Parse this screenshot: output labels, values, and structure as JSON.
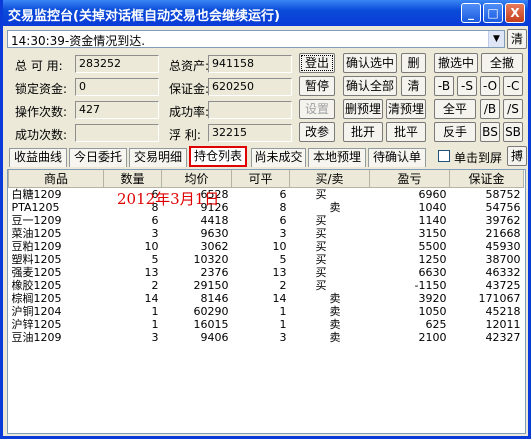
{
  "window": {
    "title": "交易监控台(关掉对话框自动交易也会继续运行)",
    "min_label": "_",
    "max_label": "□",
    "close_label": "X"
  },
  "status": {
    "message": "14:30:39-资金情况到达.",
    "clear_label": "清"
  },
  "account": {
    "available_label": "总 可 用:",
    "available_value": "283252",
    "total_assets_label": "总资产:",
    "total_assets_value": "941158",
    "locked_label": "锁定资金:",
    "locked_value": "0",
    "margin_label": "保证金:",
    "margin_value": "620250",
    "ops_label": "操作次数:",
    "ops_value": "427",
    "success_rate_label": "成功率:",
    "success_rate_value": "",
    "success_count_label": "成功次数:",
    "success_count_value": "",
    "float_pnl_label": "浮  利:",
    "float_pnl_value": "32215"
  },
  "controls": {
    "login": "登出",
    "pause": "暂停",
    "settings": "设置",
    "change_params": "改参",
    "confirm_selected": "确认选中",
    "delete": "删",
    "withdraw_selected": "撤选中",
    "withdraw_all": "全撤",
    "confirm_all": "确认全部",
    "clear": "清",
    "minus_b": "-B",
    "minus_s": "-S",
    "minus_o": "-O",
    "minus_c": "-C",
    "delete_preorder": "删预埋",
    "clear_preorder": "清预埋",
    "close_all": "全平",
    "slash_b": "/B",
    "slash_s": "/S",
    "batch_open": "批开",
    "batch_close": "批平",
    "reverse": "反手",
    "bs": "BS",
    "sb": "SB"
  },
  "tabs": [
    {
      "label": "收益曲线"
    },
    {
      "label": "今日委托"
    },
    {
      "label": "交易明细"
    },
    {
      "label": "持仓列表"
    },
    {
      "label": "尚未成交"
    },
    {
      "label": "本地预埋"
    },
    {
      "label": "待确认单"
    }
  ],
  "pin_to_front": {
    "label": "单击到屏",
    "checked": false
  },
  "pin_button": "搏",
  "positions": {
    "columns": [
      "商品",
      "数量",
      "均价",
      "可平",
      "买/卖",
      "盈亏",
      "保证金"
    ],
    "rows": [
      [
        "白糖1209",
        "6",
        "6528",
        "6",
        "买",
        "6960",
        "58752"
      ],
      [
        "PTA1205",
        "8",
        "9126",
        "8",
        "卖",
        "1040",
        "54756"
      ],
      [
        "豆一1209",
        "6",
        "4418",
        "6",
        "买",
        "1140",
        "39762"
      ],
      [
        "菜油1205",
        "3",
        "9630",
        "3",
        "买",
        "3150",
        "21668"
      ],
      [
        "豆粕1209",
        "10",
        "3062",
        "10",
        "买",
        "5500",
        "45930"
      ],
      [
        "塑料1205",
        "5",
        "10320",
        "5",
        "买",
        "1250",
        "38700"
      ],
      [
        "强麦1205",
        "13",
        "2376",
        "13",
        "买",
        "6630",
        "46332"
      ],
      [
        "橡胶1205",
        "2",
        "29150",
        "2",
        "买",
        "-1150",
        "43725"
      ],
      [
        "棕榈1205",
        "14",
        "8146",
        "14",
        "卖",
        "3920",
        "171067"
      ],
      [
        "沪铜1204",
        "1",
        "60290",
        "1",
        "卖",
        "1050",
        "45218"
      ],
      [
        "沪锌1205",
        "1",
        "16015",
        "1",
        "卖",
        "625",
        "12011"
      ],
      [
        "豆油1209",
        "3",
        "9406",
        "3",
        "卖",
        "2100",
        "42327"
      ]
    ]
  },
  "watermark": "2012年3月1日"
}
